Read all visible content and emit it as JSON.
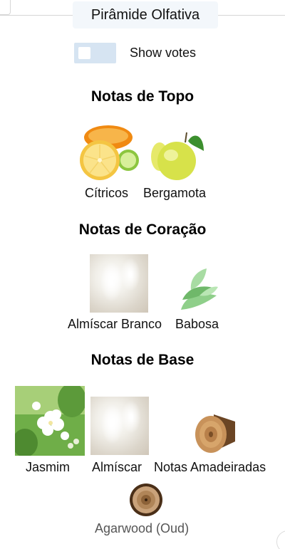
{
  "header": {
    "title": "Pirâmide Olfativa"
  },
  "toggle": {
    "label": "Show votes",
    "checked": false
  },
  "sections": {
    "top": {
      "title": "Notas de Topo",
      "notes": [
        {
          "label": "Cítricos",
          "icon": "citrus-fruits-image"
        },
        {
          "label": "Bergamota",
          "icon": "bergamot-fruit-image"
        }
      ]
    },
    "heart": {
      "title": "Notas de Coração",
      "notes": [
        {
          "label": "Almíscar Branco",
          "icon": "white-musk-image"
        },
        {
          "label": "Babosa",
          "icon": "aloe-vera-image"
        }
      ]
    },
    "base": {
      "title": "Notas de Base",
      "notes": [
        {
          "label": "Jasmim",
          "icon": "jasmine-flower-image"
        },
        {
          "label": "Almíscar",
          "icon": "musk-image"
        },
        {
          "label": "Notas Amadeiradas",
          "icon": "wood-log-image"
        },
        {
          "label": "Agarwood (Oud)",
          "icon": "agarwood-slice-image"
        }
      ]
    }
  },
  "colors": {
    "title_tab_bg": "#f3f7fb",
    "toggle_track": "#d6e4f2",
    "divider": "#d6d6d6"
  }
}
